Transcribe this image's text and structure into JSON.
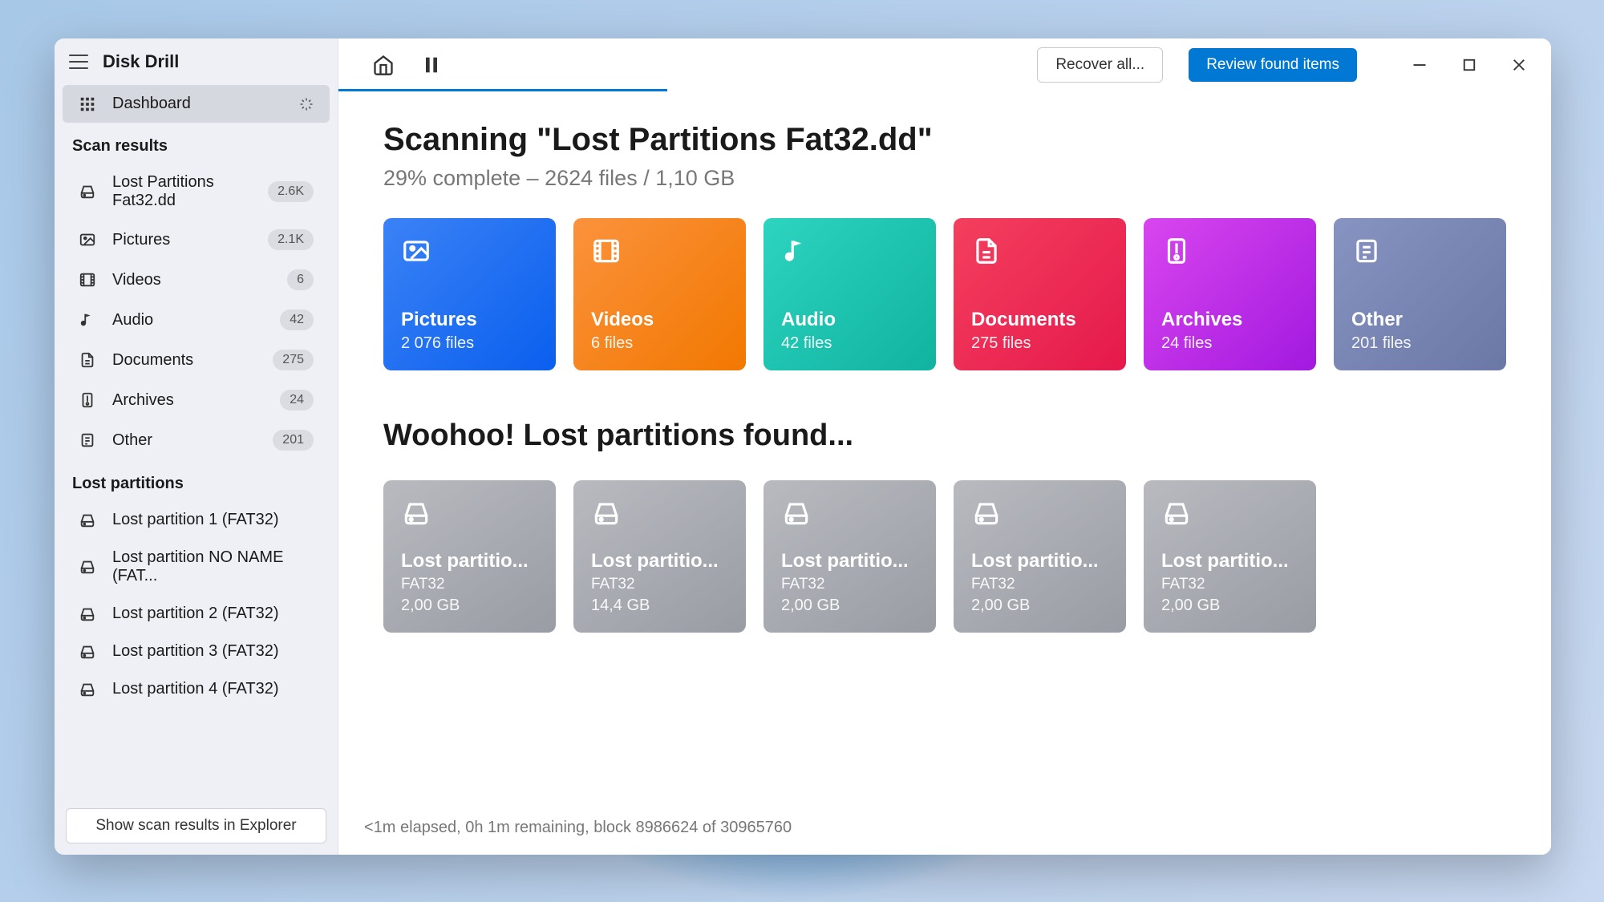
{
  "app": {
    "title": "Disk Drill"
  },
  "sidebar": {
    "dashboard": "Dashboard",
    "scan_results_header": "Scan results",
    "lost_partitions_header": "Lost partitions",
    "results": [
      {
        "label": "Lost Partitions Fat32.dd",
        "badge": "2.6K",
        "icon": "disk"
      },
      {
        "label": "Pictures",
        "badge": "2.1K",
        "icon": "image"
      },
      {
        "label": "Videos",
        "badge": "6",
        "icon": "film"
      },
      {
        "label": "Audio",
        "badge": "42",
        "icon": "music"
      },
      {
        "label": "Documents",
        "badge": "275",
        "icon": "doc"
      },
      {
        "label": "Archives",
        "badge": "24",
        "icon": "zip"
      },
      {
        "label": "Other",
        "badge": "201",
        "icon": "file"
      }
    ],
    "partitions": [
      {
        "label": "Lost partition 1 (FAT32)"
      },
      {
        "label": "Lost partition NO NAME (FAT..."
      },
      {
        "label": "Lost partition 2 (FAT32)"
      },
      {
        "label": "Lost partition 3 (FAT32)"
      },
      {
        "label": "Lost partition 4 (FAT32)"
      }
    ],
    "explorer_button": "Show scan results in Explorer"
  },
  "toolbar": {
    "recover_all": "Recover all...",
    "review": "Review found items",
    "progress_percent": 29
  },
  "scan": {
    "title": "Scanning \"Lost Partitions Fat32.dd\"",
    "subtitle": "29% complete – 2624 files / 1,10 GB"
  },
  "categories": [
    {
      "title": "Pictures",
      "subtitle": "2 076 files",
      "class": "c-pictures",
      "icon": "image"
    },
    {
      "title": "Videos",
      "subtitle": "6 files",
      "class": "c-videos",
      "icon": "film"
    },
    {
      "title": "Audio",
      "subtitle": "42 files",
      "class": "c-audio",
      "icon": "music"
    },
    {
      "title": "Documents",
      "subtitle": "275 files",
      "class": "c-documents",
      "icon": "doc"
    },
    {
      "title": "Archives",
      "subtitle": "24 files",
      "class": "c-archives",
      "icon": "zip"
    },
    {
      "title": "Other",
      "subtitle": "201 files",
      "class": "c-other",
      "icon": "file"
    }
  ],
  "partitions_section": {
    "title": "Woohoo! Lost partitions found...",
    "items": [
      {
        "title": "Lost partitio...",
        "fs": "FAT32",
        "size": "2,00 GB"
      },
      {
        "title": "Lost partitio...",
        "fs": "FAT32",
        "size": "14,4 GB"
      },
      {
        "title": "Lost partitio...",
        "fs": "FAT32",
        "size": "2,00 GB"
      },
      {
        "title": "Lost partitio...",
        "fs": "FAT32",
        "size": "2,00 GB"
      },
      {
        "title": "Lost partitio...",
        "fs": "FAT32",
        "size": "2,00 GB"
      }
    ]
  },
  "footer": {
    "status": "<1m elapsed, 0h 1m remaining, block 8986624 of 30965760"
  }
}
